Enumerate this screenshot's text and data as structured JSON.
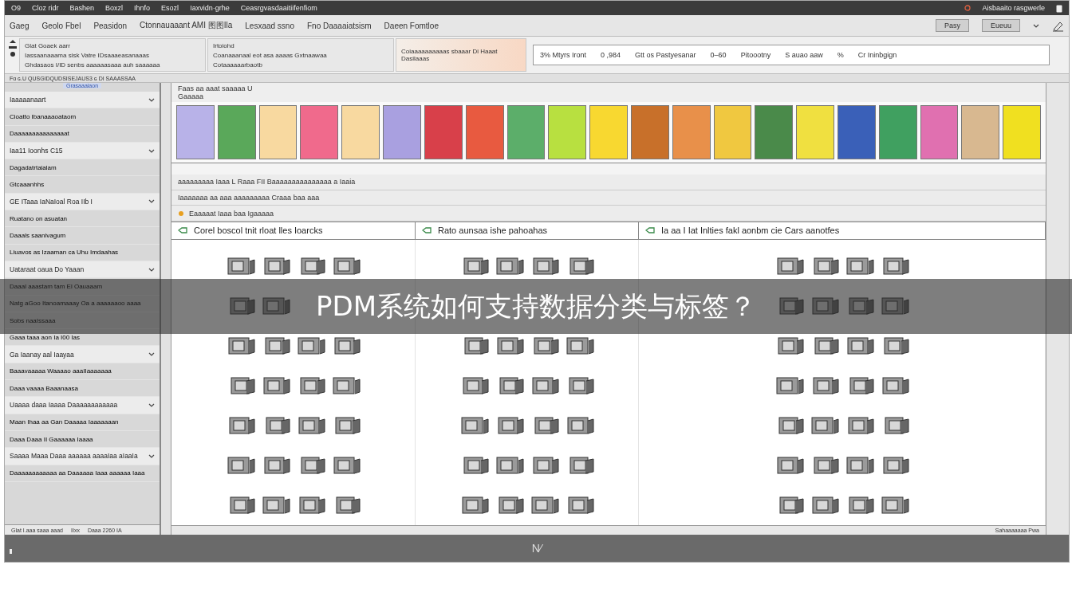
{
  "top_bar": {
    "menu": [
      "O9",
      "Cloz ridr",
      "Bashen",
      "Boxzl",
      "Ihnfo",
      "Esozl",
      "Iaxvidn·grhe",
      "Ceasrgvasdaaitiifenfiom"
    ],
    "status": "Aisbaaito rasgwerle"
  },
  "toolbar": {
    "items": [
      "Gaeg",
      "Geolo Fbel",
      "Peasidon",
      "Ctonnauaaant AMI 图图Ila",
      "Lesxaad ssno",
      "Fno Daaaaiatsism",
      "Daeen Fomtloe"
    ],
    "buttons": [
      "Pasy",
      "Eueuu"
    ]
  },
  "ribbon": {
    "groups": [
      {
        "lines": [
          "Glat Goaek aarr",
          "Iassaanaaama sisk Vatre IDsaaaeasanaaas",
          "Ghdasaos I/ID senbs aaaaaasaaa auh saaaaaa"
        ],
        "highlighted": false
      },
      {
        "lines": [
          "Irtoiohd",
          "Coanaaanaal eot asa aaaas Gxtnaawaa",
          "Cotaaaaaarbaotb"
        ],
        "highlighted": false
      },
      {
        "lines": [
          "Coiaaaaaaaaaas sbaaar Di Haaat Dasilaaas"
        ],
        "highlighted": true
      }
    ],
    "search": [
      "3% Mtyrs Iront",
      "0 ,984",
      "Gtt os Pastyesanar",
      "0–60",
      "Pitoootny",
      "S auao aaw",
      "%",
      "Cr Ininbgign"
    ]
  },
  "path_bar": "Fɑ ɢ.U QUSGIDQUDSISEJAUS3 ɢ DI SAAASSAA",
  "sidebar": {
    "tab": "Grasaaaiaon",
    "items": [
      {
        "kind": "header",
        "label": "Iaaaaanaart"
      },
      {
        "kind": "item",
        "label": "Cioatto Ibanaaaoataom"
      },
      {
        "kind": "item",
        "label": "Daaaaaaaaaaaaaaat"
      },
      {
        "kind": "header",
        "label": "Iaa11 Ioonhs C15"
      },
      {
        "kind": "item",
        "label": "Dagadatrtaialam"
      },
      {
        "kind": "item",
        "label": "Gtcaaanhhs"
      },
      {
        "kind": "header",
        "label": "GE ITaaa IaNaIoal Roa IIb I"
      },
      {
        "kind": "item",
        "label": "Ruatano on asuatan"
      },
      {
        "kind": "item",
        "label": "Daaals saanivagum"
      },
      {
        "kind": "item",
        "label": "Liuavos as Izaaman ca Uhu Imdaahas"
      },
      {
        "kind": "header",
        "label": "Uataraat oaua Do Yaaan"
      },
      {
        "kind": "item",
        "label": "Daaal aaastam tam El Oauaaam"
      },
      {
        "kind": "item",
        "label": "Natg aGoo Itanoamaaay Oa a aaaaaaoo aaaa"
      },
      {
        "kind": "item",
        "label": "Sobs naaIssaaa"
      },
      {
        "kind": "item",
        "label": "Gaaa taaa aon Ia I00 Ias"
      },
      {
        "kind": "header",
        "label": "Ga Iaanay aal Iaayaa"
      },
      {
        "kind": "item",
        "label": "Baaavaaaaa Waaaao aaaIIaaaaaaa"
      },
      {
        "kind": "item",
        "label": "Daaa vaaaa Baaanaasa"
      },
      {
        "kind": "header",
        "label": "Uaaaa daaa Iaaaa Daaaaaaaaaaaa"
      },
      {
        "kind": "item",
        "label": "Maan Ihaa aa Gan Daaaaa Iaaaaaaan"
      },
      {
        "kind": "item",
        "label": "Daaa Daaa II Gaaaaaa Iaaaa"
      },
      {
        "kind": "header",
        "label": "Saaaa Maaa Daaa aaaaaa aaaaIaa aIaaIa"
      },
      {
        "kind": "item",
        "label": "Daaaaaaaaaaaa aa Daaaaaa Iaaa aaaaaa Iaaa"
      }
    ],
    "footer": [
      "Glat I.aaa saaa aaad",
      "IIxx",
      "Daaa 2260 IA"
    ]
  },
  "main": {
    "title": "Faas aa aaat saaaaa U",
    "subtitle": "Gaaaaa",
    "swatches": [
      {
        "color": "#b8b2e8"
      },
      {
        "color": "#5aa85a"
      },
      {
        "color": "#f8d9a0"
      },
      {
        "color": "#f06a8c"
      },
      {
        "color": "#f8d9a0"
      },
      {
        "color": "#a9a0e0"
      },
      {
        "color": "#d8404a"
      },
      {
        "color": "#e85a40"
      },
      {
        "color": "#5cae6a"
      },
      {
        "color": "#b8e040"
      },
      {
        "color": "#f8d830"
      },
      {
        "color": "#c8702a"
      },
      {
        "color": "#e8904a"
      },
      {
        "color": "#f0c840"
      },
      {
        "color": "#4a8a4a"
      },
      {
        "color": "#f0e040"
      },
      {
        "color": "#3a60b8"
      },
      {
        "color": "#40a060"
      },
      {
        "color": "#e070b0"
      },
      {
        "color": "#d8b890"
      },
      {
        "color": "#f0e020"
      }
    ],
    "rows": [
      "aaaaaaaaa Iaaa L  Raaa FII Baaaaaaaaaaaaaaa a Iaaia",
      "Iaaaaaaa aa aaa aaaaaaaaa  Craaa baa aaa",
      "Eaaaaat Iaaa baa Igaaaaa"
    ],
    "columns": [
      "Corel boscol tnit rloat lles Ioarcks",
      "Rato aunsaa ishe pahoahas",
      "Ia aa  I Iat Inlties fakl aonbm cie Cars aanotfes"
    ],
    "status": "Sahaaaaaaa  Pwa"
  },
  "bottom_bar": "N⁄",
  "banner": "PDM系统如何支持数据分类与标签？"
}
